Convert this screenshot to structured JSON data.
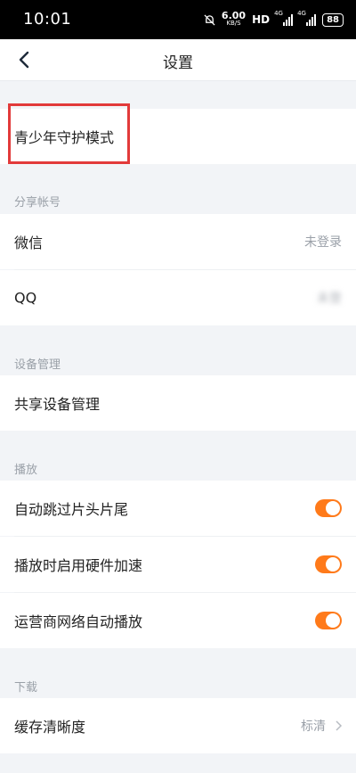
{
  "status": {
    "time": "10:01",
    "net_speed_value": "6.00",
    "net_speed_unit": "KB/S",
    "hd": "HD",
    "signal1": "4G",
    "signal2": "4G",
    "battery": "88"
  },
  "header": {
    "title": "设置",
    "back_icon": "chevron-left-icon"
  },
  "teen_mode": {
    "label": "青少年守护模式"
  },
  "share_account": {
    "section_title": "分享帐号",
    "items": [
      {
        "label": "微信",
        "value": "未登录"
      },
      {
        "label": "QQ",
        "value": "未登"
      }
    ]
  },
  "device_mgmt": {
    "section_title": "设备管理",
    "items": [
      {
        "label": "共享设备管理"
      }
    ]
  },
  "playback": {
    "section_title": "播放",
    "items": [
      {
        "label": "自动跳过片头片尾",
        "on": true
      },
      {
        "label": "播放时启用硬件加速",
        "on": true
      },
      {
        "label": "运营商网络自动播放",
        "on": true
      }
    ],
    "toggle_color": "#ff7a1a"
  },
  "download": {
    "section_title": "下载",
    "items": [
      {
        "label": "缓存清晰度",
        "value": "标清"
      }
    ]
  },
  "annotation_color": "#e23a3a"
}
